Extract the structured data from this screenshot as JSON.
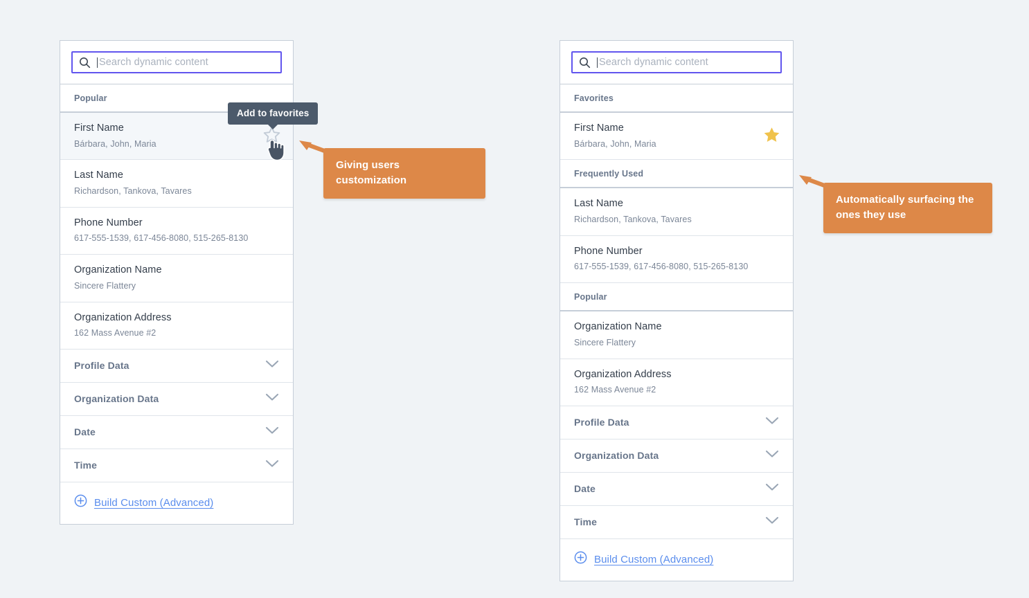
{
  "search": {
    "placeholder": "Search dynamic content",
    "value": "",
    "icon": "search-icon",
    "border_color": "#6155ee"
  },
  "colors": {
    "page_bg": "#f0f3f6",
    "panel_border": "#c6ced8",
    "accent_violet": "#6155ee",
    "link_blue": "#5a8ded",
    "star_gold": "#f0c24c",
    "callout_orange": "#dd8848",
    "tooltip_slate": "#4c5a6b"
  },
  "tooltip": {
    "label": "Add to favorites"
  },
  "cursor": {
    "icon": "pointing-hand-cursor"
  },
  "callouts": [
    {
      "id": "left",
      "text": "Giving users customization"
    },
    {
      "id": "right",
      "text": "Automatically surfacing the ones they use"
    }
  ],
  "panels": [
    {
      "id": "left",
      "sections": [
        {
          "header": "Popular",
          "rows": [
            {
              "title": "First Name",
              "sub": "Bárbara, John, Maria",
              "highlighted": true,
              "star": "outline"
            },
            {
              "title": "Last Name",
              "sub": "Richardson, Tankova, Tavares",
              "highlighted": false,
              "star": "none"
            },
            {
              "title": "Phone Number",
              "sub": "617-555-1539, 617-456-8080, 515-265-8130",
              "highlighted": false,
              "star": "none"
            },
            {
              "title": "Organization Name",
              "sub": "Sincere Flattery",
              "highlighted": false,
              "star": "none"
            },
            {
              "title": "Organization Address",
              "sub": "162 Mass Avenue #2",
              "highlighted": false,
              "star": "none"
            }
          ]
        }
      ],
      "groups": [
        {
          "label": "Profile Data",
          "icon": "chevron-down-icon"
        },
        {
          "label": "Organization Data",
          "icon": "chevron-down-icon"
        },
        {
          "label": "Date",
          "icon": "chevron-down-icon"
        },
        {
          "label": "Time",
          "icon": "chevron-down-icon"
        }
      ],
      "footer": {
        "label": "Build Custom (Advanced)",
        "icon": "plus-circle-icon"
      }
    },
    {
      "id": "right",
      "sections": [
        {
          "header": "Favorites",
          "rows": [
            {
              "title": "First Name",
              "sub": "Bárbara, John, Maria",
              "highlighted": false,
              "star": "filled"
            }
          ]
        },
        {
          "header": "Frequently Used",
          "rows": [
            {
              "title": "Last Name",
              "sub": "Richardson, Tankova, Tavares",
              "highlighted": false,
              "star": "none"
            },
            {
              "title": "Phone Number",
              "sub": "617-555-1539, 617-456-8080, 515-265-8130",
              "highlighted": false,
              "star": "none"
            }
          ]
        },
        {
          "header": "Popular",
          "rows": [
            {
              "title": "Organization Name",
              "sub": "Sincere Flattery",
              "highlighted": false,
              "star": "none"
            },
            {
              "title": "Organization Address",
              "sub": "162 Mass Avenue #2",
              "highlighted": false,
              "star": "none"
            }
          ]
        }
      ],
      "groups": [
        {
          "label": "Profile Data",
          "icon": "chevron-down-icon"
        },
        {
          "label": "Organization Data",
          "icon": "chevron-down-icon"
        },
        {
          "label": "Date",
          "icon": "chevron-down-icon"
        },
        {
          "label": "Time",
          "icon": "chevron-down-icon"
        }
      ],
      "footer": {
        "label": "Build Custom (Advanced)",
        "icon": "plus-circle-icon"
      }
    }
  ]
}
